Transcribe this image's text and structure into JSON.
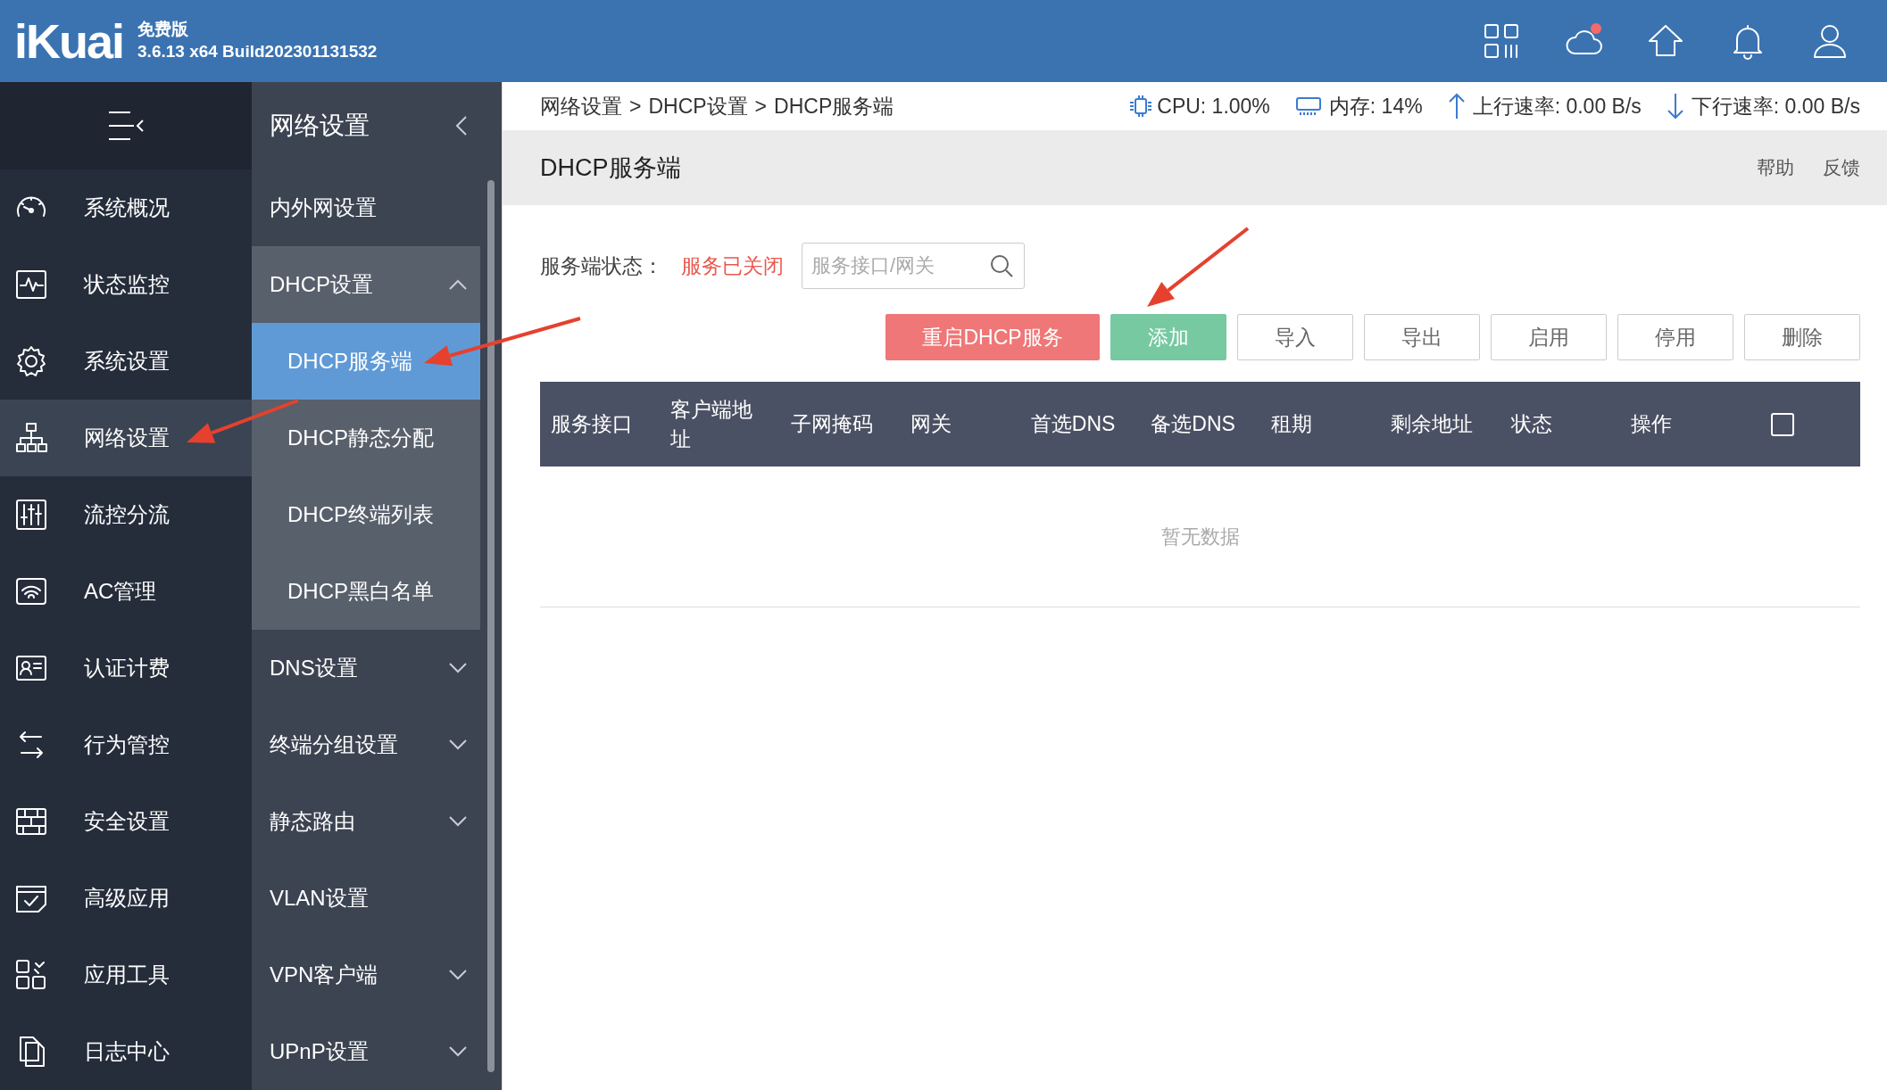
{
  "header": {
    "logo": "iKuai",
    "edition": "免费版",
    "version": "3.6.13 x64 Build202301131532"
  },
  "nav": {
    "items": [
      {
        "label": "系统概况",
        "selected": false
      },
      {
        "label": "状态监控",
        "selected": false
      },
      {
        "label": "系统设置",
        "selected": false
      },
      {
        "label": "网络设置",
        "selected": true
      },
      {
        "label": "流控分流",
        "selected": false
      },
      {
        "label": "AC管理",
        "selected": false
      },
      {
        "label": "认证计费",
        "selected": false
      },
      {
        "label": "行为管控",
        "selected": false
      },
      {
        "label": "安全设置",
        "selected": false
      },
      {
        "label": "高级应用",
        "selected": false
      },
      {
        "label": "应用工具",
        "selected": false
      },
      {
        "label": "日志中心",
        "selected": false
      }
    ]
  },
  "submenu": {
    "title": "网络设置",
    "items": [
      {
        "label": "内外网设置"
      },
      {
        "label": "DHCP设置",
        "expanded": true,
        "children": [
          {
            "label": "DHCP服务端",
            "selected": true
          },
          {
            "label": "DHCP静态分配",
            "selected": false
          },
          {
            "label": "DHCP终端列表",
            "selected": false
          },
          {
            "label": "DHCP黑白名单",
            "selected": false
          }
        ]
      },
      {
        "label": "DNS设置",
        "expanded": false
      },
      {
        "label": "终端分组设置",
        "expanded": false
      },
      {
        "label": "静态路由",
        "expanded": false
      },
      {
        "label": "VLAN设置"
      },
      {
        "label": "VPN客户端",
        "expanded": false
      },
      {
        "label": "UPnP设置",
        "expanded": false
      }
    ]
  },
  "status_bar": {
    "breadcrumb": [
      "网络设置",
      "DHCP设置",
      "DHCP服务端"
    ],
    "separator": ">",
    "cpu": "CPU: 1.00%",
    "memory": "内存: 14%",
    "upload": "上行速率: 0.00 B/s",
    "download": "下行速率: 0.00 B/s"
  },
  "page": {
    "title": "DHCP服务端",
    "links": [
      "帮助",
      "反馈"
    ],
    "status_label": "服务端状态：",
    "status_value": "服务已关闭",
    "search": {
      "placeholder": "服务接口/网关"
    },
    "buttons": [
      {
        "label": "重启DHCP服务",
        "kind": "danger"
      },
      {
        "label": "添加",
        "kind": "success"
      },
      {
        "label": "导入",
        "kind": "plain"
      },
      {
        "label": "导出",
        "kind": "plain"
      },
      {
        "label": "启用",
        "kind": "plain"
      },
      {
        "label": "停用",
        "kind": "plain"
      },
      {
        "label": "删除",
        "kind": "plain"
      }
    ]
  },
  "table": {
    "columns": [
      "服务接口",
      "客户端地址",
      "子网掩码",
      "网关",
      "首选DNS",
      "备选DNS",
      "租期",
      "剩余地址",
      "状态",
      "操作"
    ],
    "select_all": {
      "checked": false
    },
    "empty_text": "暂无数据"
  }
}
